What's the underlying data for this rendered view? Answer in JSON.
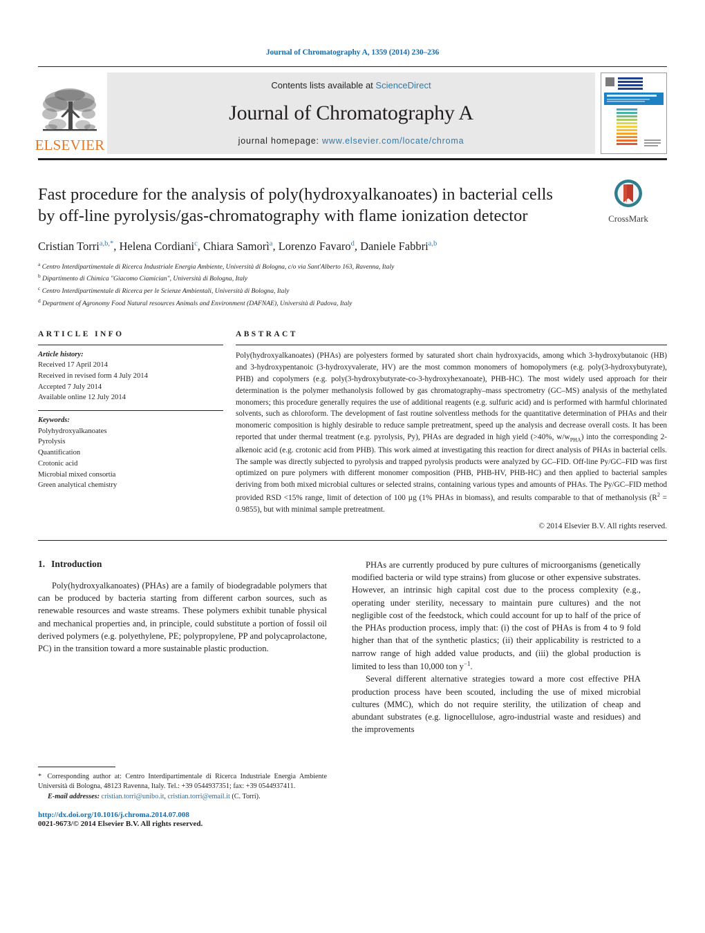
{
  "running_head": "Journal of Chromatography A, 1359 (2014) 230–236",
  "masthead": {
    "publisher_name": "ELSEVIER",
    "contents_prefix": "Contents lists available at ",
    "contents_link": "ScienceDirect",
    "journal_title": "Journal of Chromatography A",
    "homepage_prefix": "journal homepage: ",
    "homepage_url": "www.elsevier.com/locate/chroma",
    "cover_title": "JOURNAL OF CHROMATOGRAPHY A"
  },
  "crossmark": {
    "label": "CrossMark"
  },
  "article": {
    "title": "Fast procedure for the analysis of poly(hydroxyalkanoates) in bacterial cells by off-line pyrolysis/gas-chromatography with flame ionization detector",
    "authors": [
      {
        "name": "Cristian Torri",
        "marks": "a,b,",
        "star": true
      },
      {
        "name": "Helena Cordiani",
        "marks": "c",
        "star": false
      },
      {
        "name": "Chiara Samorì",
        "marks": "a",
        "star": false
      },
      {
        "name": "Lorenzo Favaro",
        "marks": "d",
        "star": false
      },
      {
        "name": "Daniele Fabbri",
        "marks": "a,b",
        "star": false
      }
    ],
    "affiliations": [
      {
        "mark": "a",
        "text": "Centro Interdipartimentale di Ricerca Industriale Energia Ambiente, Università di Bologna, c/o via Sant'Alberto 163, Ravenna, Italy"
      },
      {
        "mark": "b",
        "text": "Dipartimento di Chimica \"Giacomo Ciamician\", Università di Bologna, Italy"
      },
      {
        "mark": "c",
        "text": "Centro Interdipartimentale di Ricerca per le Scienze Ambientali, Università di Bologna, Italy"
      },
      {
        "mark": "d",
        "text": "Department of Agronomy Food Natural resources Animals and Environment (DAFNAE), Università di Padova, Italy"
      }
    ]
  },
  "article_info": {
    "heading": "ARTICLE INFO",
    "history_label": "Article history:",
    "history": [
      "Received 17 April 2014",
      "Received in revised form 4 July 2014",
      "Accepted 7 July 2014",
      "Available online 12 July 2014"
    ],
    "keywords_label": "Keywords:",
    "keywords": [
      "Polyhydroxyalkanoates",
      "Pyrolysis",
      "Quantification",
      "Crotonic acid",
      "Microbial mixed consortia",
      "Green analytical chemistry"
    ]
  },
  "abstract": {
    "heading": "ABSTRACT",
    "part1": "Poly(hydroxyalkanoates) (PHAs) are polyesters formed by saturated short chain hydroxyacids, among which 3-hydroxybutanoic (HB) and 3-hydroxypentanoic (3-hydroxyvalerate, HV) are the most common monomers of homopolymers (e.g. poly(3-hydroxybutyrate), PHB) and copolymers (e.g. poly(3-hydroxybutyrate-co-3-hydroxyhexanoate), PHB-HC). The most widely used approach for their determination is the polymer methanolysis followed by gas chromatography–mass spectrometry (GC–MS) analysis of the methylated monomers; this procedure generally requires the use of additional reagents (e.g. sulfuric acid) and is performed with harmful chlorinated solvents, such as chloroform. The development of fast routine solventless methods for the quantitative determination of PHAs and their monomeric composition is highly desirable to reduce sample pretreatment, speed up the analysis and decrease overall costs. It has been reported that under thermal treatment (e.g. pyrolysis, Py), PHAs are degraded in high yield (>40%, w/w",
    "sub1": "PHA",
    "part2": ") into the corresponding 2-alkenoic acid (e.g. crotonic acid from PHB). This work aimed at investigating this reaction for direct analysis of PHAs in bacterial cells. The sample was directly subjected to pyrolysis and trapped pyrolysis products were analyzed by GC–FID. Off-line Py/GC–FID was first optimized on pure polymers with different monomer composition (PHB, PHB-HV, PHB-HC) and then applied to bacterial samples deriving from both mixed microbial cultures or selected strains, containing various types and amounts of PHAs. The Py/GC–FID method provided RSD <15% range, limit of detection of 100 µg (1% PHAs in biomass), and results comparable to that of methanolysis (R",
    "sup1": "2",
    "part3": " = 0.9855), but with minimal sample pretreatment.",
    "copyright": "© 2014 Elsevier B.V. All rights reserved."
  },
  "body": {
    "section_number": "1.",
    "section_title": "Introduction",
    "left_paragraphs": [
      "Poly(hydroxyalkanoates) (PHAs) are a family of biodegradable polymers that can be produced by bacteria starting from different carbon sources, such as renewable resources and waste streams. These polymers exhibit tunable physical and mechanical properties and, in principle, could substitute a portion of fossil oil derived polymers (e.g. polyethylene, PE; polypropylene, PP and polycaprolactone, PC) in the transition toward a more sustainable plastic production."
    ],
    "right_paragraph_1a": "PHAs are currently produced by pure cultures of microorganisms (genetically modified bacteria or wild type strains) from glucose or other expensive substrates. However, an intrinsic high capital cost due to the process complexity (e.g., operating under sterility, necessary to maintain pure cultures) and the not negligible cost of the feedstock, which could account for up to half of the price of the PHAs production process, imply that: (i) the cost of PHAs is from 4 to 9 fold higher than that of the synthetic plastics; (ii) their applicability is restricted to a narrow range of high added value products, and (iii) the global production is limited to less than 10,000 ton y",
    "right_paragraph_1_sup": "−1",
    "right_paragraph_1b": ".",
    "right_paragraph_2": "Several different alternative strategies toward a more cost effective PHA production process have been scouted, including the use of mixed microbial cultures (MMC), which do not require sterility, the utilization of cheap and abundant substrates (e.g. lignocellulose, agro-industrial waste and residues) and the improvements"
  },
  "footnote": {
    "star": "*",
    "corresponding": "Corresponding author at: Centro Interdipartimentale di Ricerca Industriale Energia Ambiente Università di Bologna, 48123 Ravenna, Italy. Tel.: +39 0544937351; fax: +39 0544937411.",
    "email_label": "E-mail addresses:",
    "email_1": "cristian.torri@unibo.it",
    "email_sep": ", ",
    "email_2": "cristian.torri@email.it",
    "email_suffix": " (C. Torri).",
    "doi": "http://dx.doi.org/10.1016/j.chroma.2014.07.008",
    "issn": "0021-9673/© 2014 Elsevier B.V. All rights reserved."
  },
  "colors": {
    "link": "#1a6ca8",
    "elsevier_orange": "#e87722",
    "sciencedirect_blue": "#2a7ab0",
    "crossmark_red": "#c0392b",
    "crossmark_teal": "#2e7e8f"
  }
}
